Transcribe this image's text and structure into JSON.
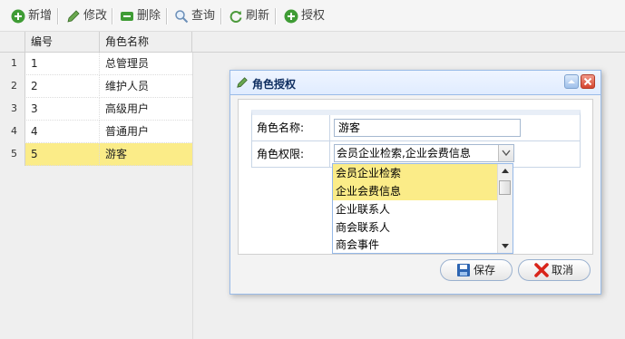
{
  "toolbar": {
    "add_label": "新增",
    "edit_label": "修改",
    "delete_label": "删除",
    "query_label": "查询",
    "refresh_label": "刷新",
    "grant_label": "授权"
  },
  "grid": {
    "columns": [
      "编号",
      "角色名称"
    ],
    "rows": [
      {
        "rownum": "1",
        "id": "1",
        "name": "总管理员"
      },
      {
        "rownum": "2",
        "id": "2",
        "name": "维护人员"
      },
      {
        "rownum": "3",
        "id": "3",
        "name": "高级用户"
      },
      {
        "rownum": "4",
        "id": "4",
        "name": "普通用户"
      },
      {
        "rownum": "5",
        "id": "5",
        "name": "游客"
      }
    ],
    "selected_row": 5
  },
  "dialog": {
    "title": "角色授权",
    "role_name_label": "角色名称:",
    "role_name_value": "游客",
    "permission_label": "角色权限:",
    "permission_value": "会员企业检索,企业会费信息",
    "options": [
      "会员企业检索",
      "企业会费信息",
      "企业联系人",
      "商会联系人",
      "商会事件"
    ],
    "selected_options": [
      "会员企业检索",
      "企业会费信息"
    ],
    "save_label": "保存",
    "cancel_label": "取消"
  },
  "colors": {
    "selection": "#fbec88",
    "dialog_border": "#99bbe8",
    "title_text": "#0e2d5f"
  },
  "icons": [
    "add-icon",
    "edit-icon",
    "delete-icon",
    "search-icon",
    "refresh-icon",
    "grant-icon",
    "pencil-icon",
    "collapse-icon",
    "close-icon",
    "save-icon",
    "cancel-icon",
    "chevron-down-icon"
  ]
}
